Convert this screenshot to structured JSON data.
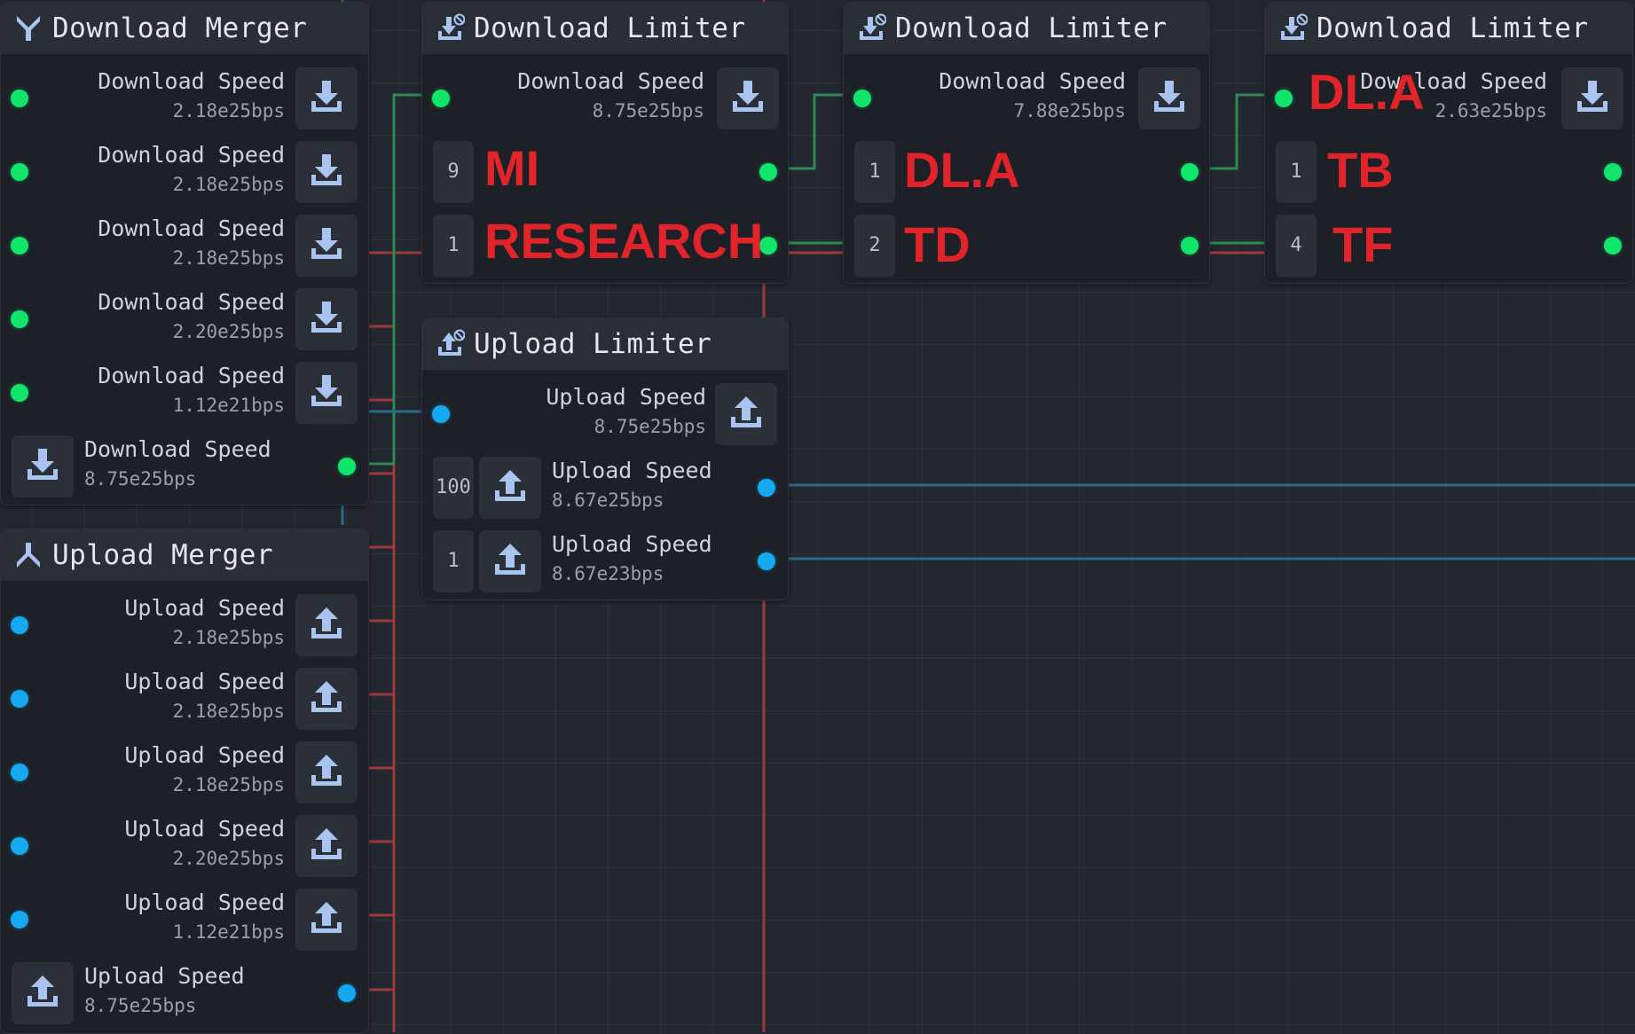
{
  "colors": {
    "download": "#11e56b",
    "upload": "#16a8f0",
    "wire_red": "#9c3a3e"
  },
  "download_merger": {
    "title": "Download Merger",
    "icon": "merge-down-icon",
    "inputs": [
      {
        "label": "Download Speed",
        "value": "2.18e25bps"
      },
      {
        "label": "Download Speed",
        "value": "2.18e25bps"
      },
      {
        "label": "Download Speed",
        "value": "2.18e25bps"
      },
      {
        "label": "Download Speed",
        "value": "2.20e25bps"
      },
      {
        "label": "Download Speed",
        "value": "1.12e21bps"
      }
    ],
    "output": {
      "label": "Download Speed",
      "value": "8.75e25bps"
    }
  },
  "upload_merger": {
    "title": "Upload Merger",
    "icon": "merge-up-icon",
    "inputs": [
      {
        "label": "Upload Speed",
        "value": "2.18e25bps"
      },
      {
        "label": "Upload Speed",
        "value": "2.18e25bps"
      },
      {
        "label": "Upload Speed",
        "value": "2.18e25bps"
      },
      {
        "label": "Upload Speed",
        "value": "2.20e25bps"
      },
      {
        "label": "Upload Speed",
        "value": "1.12e21bps"
      }
    ],
    "output": {
      "label": "Upload Speed",
      "value": "8.75e25bps"
    }
  },
  "download_limiters": [
    {
      "title": "Download Limiter",
      "input": {
        "label": "Download Speed",
        "value": "8.75e25bps"
      },
      "outputs": [
        {
          "count": "9"
        },
        {
          "count": "1"
        }
      ]
    },
    {
      "title": "Download Limiter",
      "input": {
        "label": "Download Speed",
        "value": "7.88e25bps"
      },
      "outputs": [
        {
          "count": "1"
        },
        {
          "count": "2"
        }
      ]
    },
    {
      "title": "Download Limiter",
      "input": {
        "label": "Download Speed",
        "value": "2.63e25bps"
      },
      "outputs": [
        {
          "count": "1"
        },
        {
          "count": "4"
        }
      ]
    }
  ],
  "upload_limiter": {
    "title": "Upload Limiter",
    "input": {
      "label": "Upload Speed",
      "value": "8.75e25bps"
    },
    "outputs": [
      {
        "count": "100",
        "label": "Upload Speed",
        "value": "8.67e25bps"
      },
      {
        "count": "1",
        "label": "Upload Speed",
        "value": "8.67e23bps"
      }
    ]
  },
  "annotations": {
    "mi": "MI",
    "research": "RESEARCH",
    "dla_1": "DL.A",
    "td": "TD",
    "dla_2": "DL.A",
    "tb": "TB",
    "tf": "TF"
  }
}
